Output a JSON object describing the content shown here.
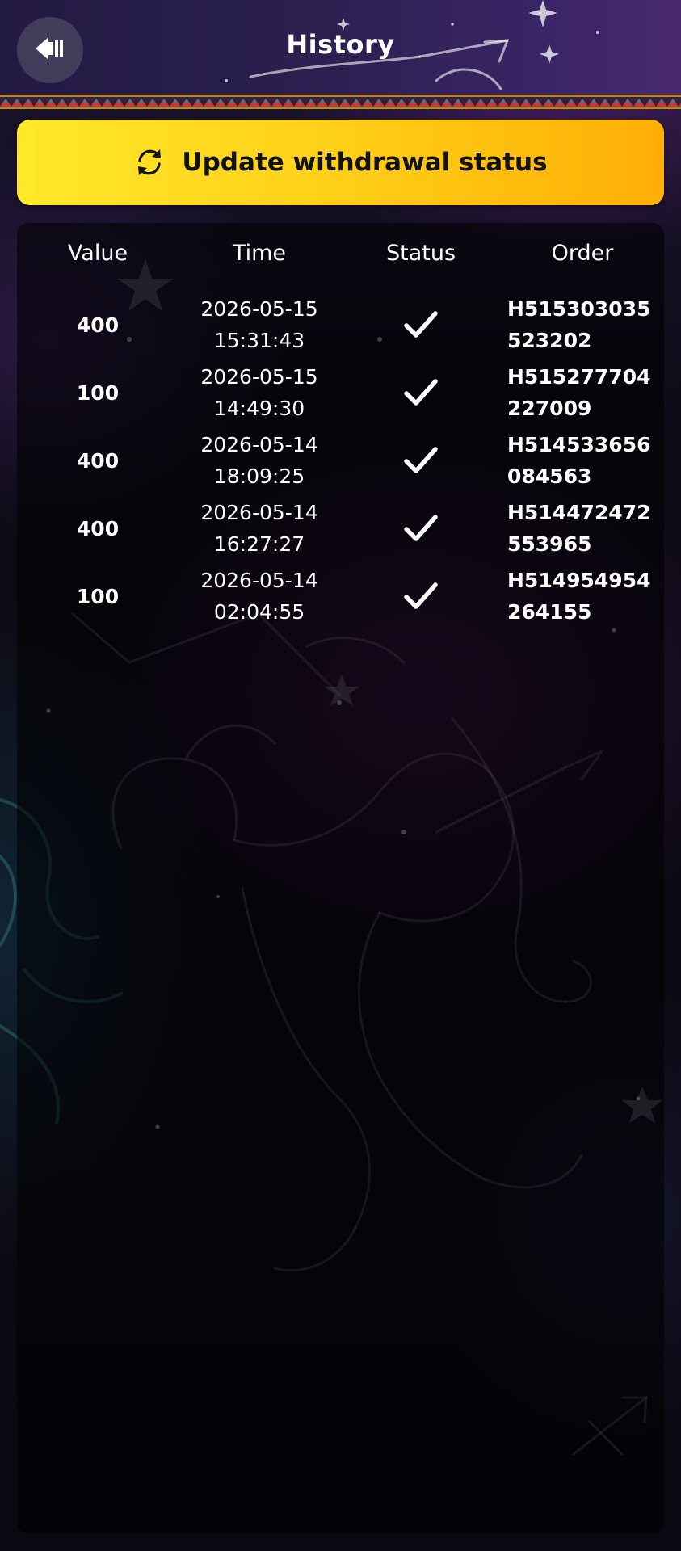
{
  "header": {
    "title": "History",
    "back_icon": "back-arrow-icon"
  },
  "update_button": {
    "label": "Update withdrawal status",
    "icon": "refresh-icon"
  },
  "table": {
    "columns": [
      "Value",
      "Time",
      "Status",
      "Order"
    ],
    "rows": [
      {
        "value": "400",
        "date": "2026-05-15",
        "time": "15:31:43",
        "status": "check-icon",
        "order": "H515303035523202"
      },
      {
        "value": "100",
        "date": "2026-05-15",
        "time": "14:49:30",
        "status": "check-icon",
        "order": "H515277704227009"
      },
      {
        "value": "400",
        "date": "2026-05-14",
        "time": "18:09:25",
        "status": "check-icon",
        "order": "H514533656084563"
      },
      {
        "value": "400",
        "date": "2026-05-14",
        "time": "16:27:27",
        "status": "check-icon",
        "order": "H514472472553965"
      },
      {
        "value": "100",
        "date": "2026-05-14",
        "time": "02:04:55",
        "status": "check-icon",
        "order": "H514954954264155"
      }
    ]
  },
  "colors": {
    "accent_start": "#ffe82a",
    "accent_end": "#ffae05",
    "header_bg": "#2a1f4e"
  }
}
